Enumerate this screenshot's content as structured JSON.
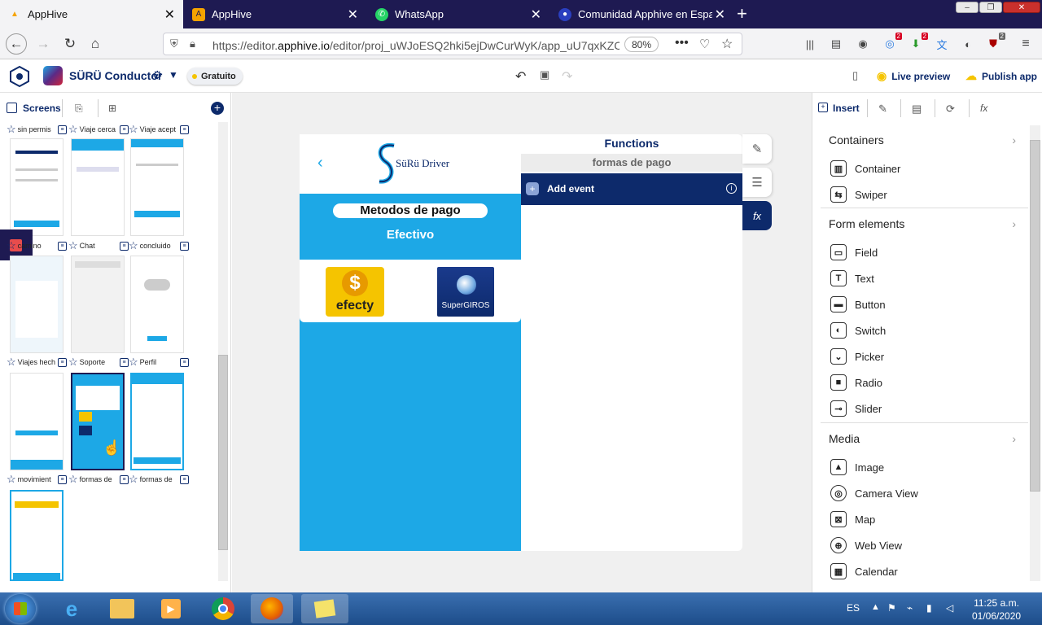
{
  "browser": {
    "tabs": [
      {
        "title": "AppHive",
        "active": true
      },
      {
        "title": "AppHive",
        "active": false
      },
      {
        "title": "WhatsApp",
        "active": false
      },
      {
        "title": "Comunidad Apphive en Españ...",
        "active": false
      }
    ],
    "url_prefix": "https://editor.",
    "url_domain": "apphive.io",
    "url_rest": "/editor/proj_uWJoESQ2hki5ejDwCurWyK/app_uU7qxKZC",
    "zoom": "80%",
    "badges": [
      "2",
      "2",
      "2"
    ]
  },
  "header": {
    "app_name": "SÜRÜ Conductor",
    "plan": "Gratuito",
    "live_preview": "Live preview",
    "publish": "Publish app"
  },
  "left_panel": {
    "screens_label": "Screens",
    "add": "+",
    "top_labels": [
      "sin permis",
      "Viaje cerca",
      "Viaje acept"
    ],
    "screens": [
      {
        "label": "camino"
      },
      {
        "label": "Chat"
      },
      {
        "label": "concluido"
      },
      {
        "label": "Viajes hech"
      },
      {
        "label": "Soporte"
      },
      {
        "label": "Perfil"
      },
      {
        "label": "movimient"
      },
      {
        "label": "formas de"
      },
      {
        "label": "formas de"
      }
    ]
  },
  "phone": {
    "brand": "SüRü Driver",
    "title": "Metodos de pago",
    "subtitle": "Efectivo",
    "logo1": "efecty",
    "logo2": "SuperGIROS"
  },
  "functions": {
    "title": "Functions",
    "screen_name": "formas de pago",
    "add_event": "Add event"
  },
  "right_panel": {
    "insert_tab": "Insert",
    "sections": [
      {
        "title": "Containers",
        "items": [
          "Container",
          "Swiper"
        ]
      },
      {
        "title": "Form elements",
        "items": [
          "Field",
          "Text",
          "Button",
          "Switch",
          "Picker",
          "Radio",
          "Slider"
        ]
      },
      {
        "title": "Media",
        "items": [
          "Image",
          "Camera View",
          "Map",
          "Web View",
          "Calendar"
        ]
      }
    ]
  },
  "taskbar": {
    "lang": "ES",
    "time": "11:25 a.m.",
    "date": "01/06/2020"
  },
  "colors": {
    "navy": "#0d2a6b",
    "sky": "#1da8e6",
    "tabbar": "#1e1a52",
    "yellow": "#f5c400"
  }
}
